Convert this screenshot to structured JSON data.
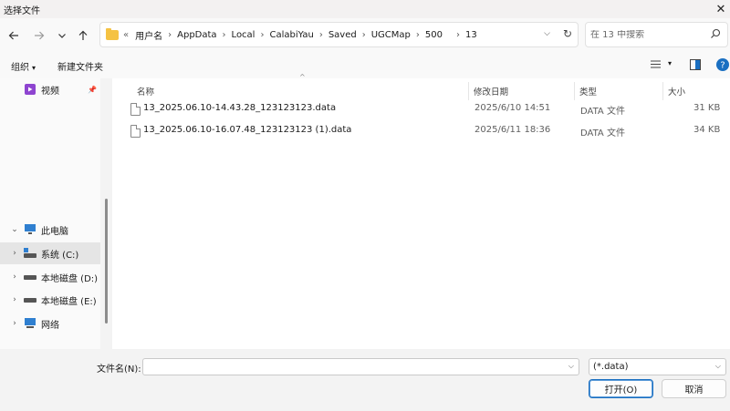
{
  "window": {
    "title": "选择文件"
  },
  "nav": {
    "back_icon": "arrow-left-icon",
    "forward_icon": "arrow-right-icon",
    "recent_icon": "chevron-down-icon",
    "up_icon": "arrow-up-icon",
    "overflow": "«",
    "breadcrumbs": [
      "用户名",
      "AppData",
      "Local",
      "CalabiYau",
      "Saved",
      "UGCMap",
      "500",
      "13"
    ],
    "search_placeholder": "在 13 中搜索"
  },
  "toolbar": {
    "organize": "组织",
    "new_folder": "新建文件夹"
  },
  "sidebar": {
    "items": [
      {
        "label": "视频",
        "icon": "video-folder-icon"
      },
      {
        "label": "此电脑",
        "icon": "computer-icon"
      },
      {
        "label": "系统 (C:)",
        "icon": "drive-icon"
      },
      {
        "label": "本地磁盘 (D:)",
        "icon": "drive-icon"
      },
      {
        "label": "本地磁盘 (E:)",
        "icon": "drive-icon"
      },
      {
        "label": "网络",
        "icon": "network-icon"
      }
    ]
  },
  "files": {
    "columns": {
      "name": "名称",
      "date": "修改日期",
      "type": "类型",
      "size": "大小"
    },
    "rows": [
      {
        "name": "13_2025.06.10-14.43.28_123123123.data",
        "date": "2025/6/10 14:51",
        "type": "DATA 文件",
        "size": "31 KB"
      },
      {
        "name": "13_2025.06.10-16.07.48_123123123 (1).data",
        "date": "2025/6/11 18:36",
        "type": "DATA 文件",
        "size": "34 KB"
      }
    ]
  },
  "footer": {
    "filename_label": "文件名(N):",
    "filename_value": "",
    "filetype": "(*.data)",
    "open": "打开(O)",
    "cancel": "取消"
  },
  "colors": {
    "accent": "#1a6fc1",
    "folder": "#f5c242",
    "selected": "#e5e5e5"
  }
}
